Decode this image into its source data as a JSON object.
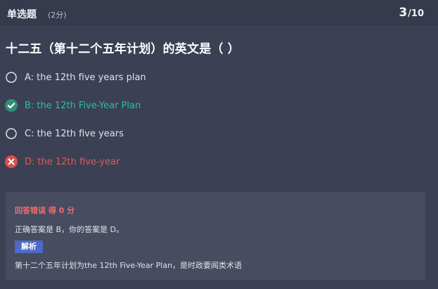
{
  "header": {
    "question_type": "单选题",
    "points": "(2分)",
    "current": "3",
    "total": "/10"
  },
  "question": {
    "title": "十二五（第十二个五年计划）的英文是（ ）"
  },
  "options": [
    {
      "label": "A: the 12th five years plan",
      "state": "unselected"
    },
    {
      "label": "B: the 12th Five-Year Plan",
      "state": "correct"
    },
    {
      "label": "C: the 12th five years",
      "state": "unselected"
    },
    {
      "label": "D: the 12th five-year",
      "state": "wrong"
    }
  ],
  "result": {
    "status": "回答错误 得 0 分",
    "answer_text": "正确答案是 B，你的答案是 D。",
    "analysis_label": "解析",
    "analysis_text": "第十二个五年计划为the 12th Five-Year Plan，是时政要闻类术语"
  },
  "colors": {
    "background": "#3b4054",
    "correct": "#1ec6a0",
    "wrong": "#e15a5a",
    "analysis_badge": "#4d69c9"
  },
  "icons": {
    "unselected": "radio-unselected-icon",
    "correct": "check-circle-icon",
    "wrong": "x-circle-icon"
  }
}
